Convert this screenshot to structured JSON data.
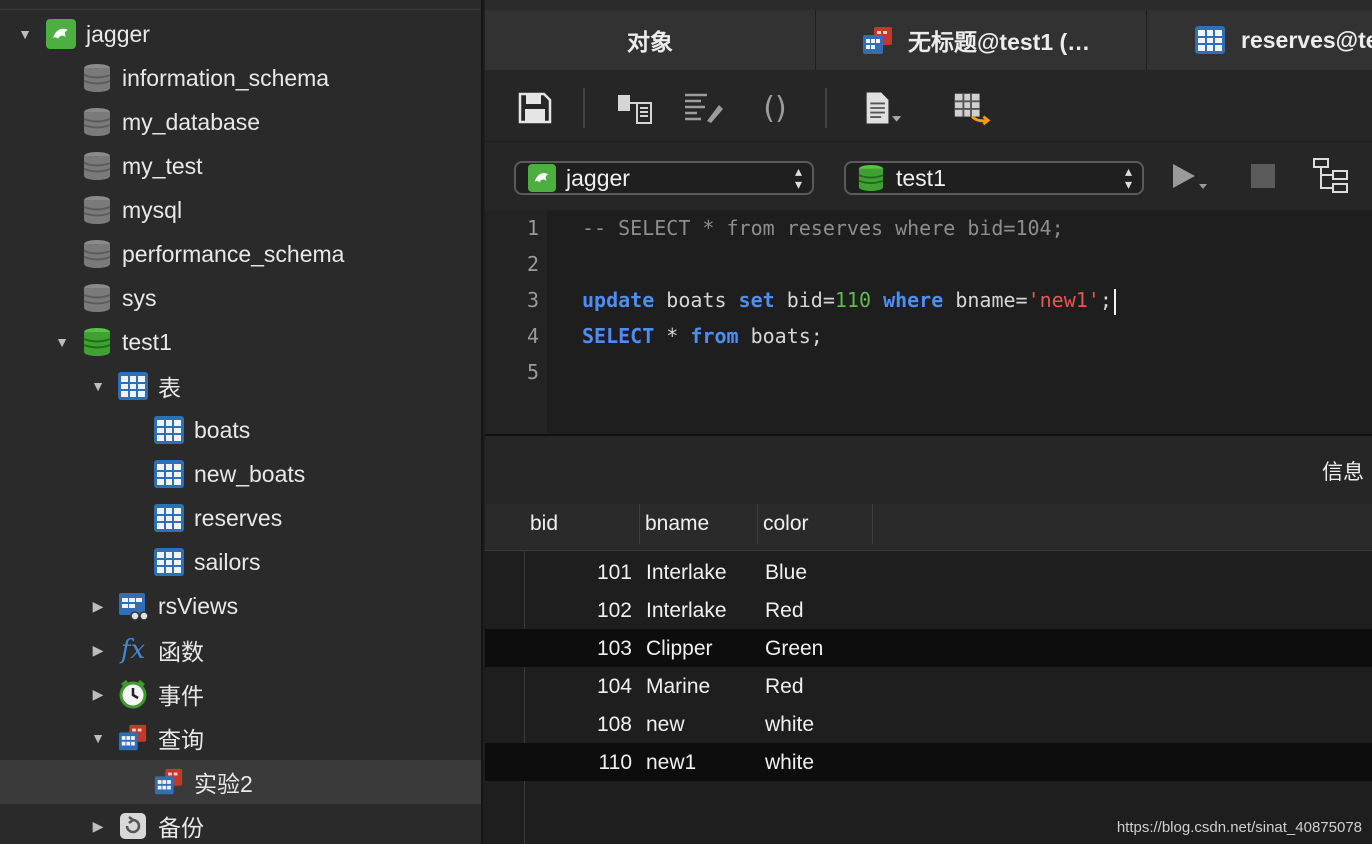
{
  "sidebar": {
    "connection": {
      "label": "jagger",
      "icon": "mysql-dolphin-icon"
    },
    "databases": [
      {
        "label": "information_schema"
      },
      {
        "label": "my_database"
      },
      {
        "label": "my_test"
      },
      {
        "label": "mysql"
      },
      {
        "label": "performance_schema"
      },
      {
        "label": "sys"
      }
    ],
    "open_database": {
      "label": "test1"
    },
    "tables_group": {
      "label": "表"
    },
    "tables": [
      {
        "label": "boats"
      },
      {
        "label": "new_boats"
      },
      {
        "label": "reserves"
      },
      {
        "label": "sailors"
      }
    ],
    "views_group": {
      "label": "rsViews"
    },
    "functions_group": {
      "label": "函数"
    },
    "events_group": {
      "label": "事件"
    },
    "queries_group": {
      "label": "查询"
    },
    "queries": [
      {
        "label": "实验2"
      }
    ],
    "backup_group": {
      "label": "备份"
    }
  },
  "tabs": [
    {
      "label": "对象"
    },
    {
      "label": "无标题@test1 (…"
    },
    {
      "label": "reserves@te"
    }
  ],
  "toolbar": {
    "buttons": [
      "save-icon",
      "query-builder-icon",
      "beautify-sql-icon",
      "parentheses-icon",
      "text-snippet-icon",
      "export-result-icon"
    ]
  },
  "selectors": {
    "connection_value": "jagger",
    "database_value": "test1"
  },
  "editor": {
    "line_numbers": [
      "1",
      "2",
      "3",
      "4",
      "5"
    ],
    "line1": "-- SELECT * from reserves where bid=104;",
    "line3": {
      "k_update": "update",
      "t1": " boats ",
      "k_set": "set",
      "t2": " bid=",
      "n110": "110",
      "t3": " ",
      "k_where": "where",
      "t4": " bname=",
      "s_new1": "'new1'",
      "t5": ";"
    },
    "line4": {
      "k_select": "SELECT",
      "t1": " * ",
      "k_from": "from",
      "t2": " boats;"
    }
  },
  "result": {
    "info_tab_label": "信息",
    "columns": [
      "bid",
      "bname",
      "color"
    ],
    "rows": [
      {
        "bid": "101",
        "bname": "Interlake",
        "color": "Blue"
      },
      {
        "bid": "102",
        "bname": "Interlake",
        "color": "Red"
      },
      {
        "bid": "103",
        "bname": "Clipper",
        "color": "Green"
      },
      {
        "bid": "104",
        "bname": "Marine",
        "color": "Red"
      },
      {
        "bid": "108",
        "bname": "new",
        "color": "white"
      },
      {
        "bid": "110",
        "bname": "new1",
        "color": "white"
      }
    ]
  },
  "watermark": "https://blog.csdn.net/sinat_40875078",
  "colors": {
    "keyword": "#4d8ef5",
    "number": "#5dbb4a",
    "string": "#e8554e",
    "mysql_green": "#4caf3f",
    "table_blue": "#2f6fb7"
  }
}
